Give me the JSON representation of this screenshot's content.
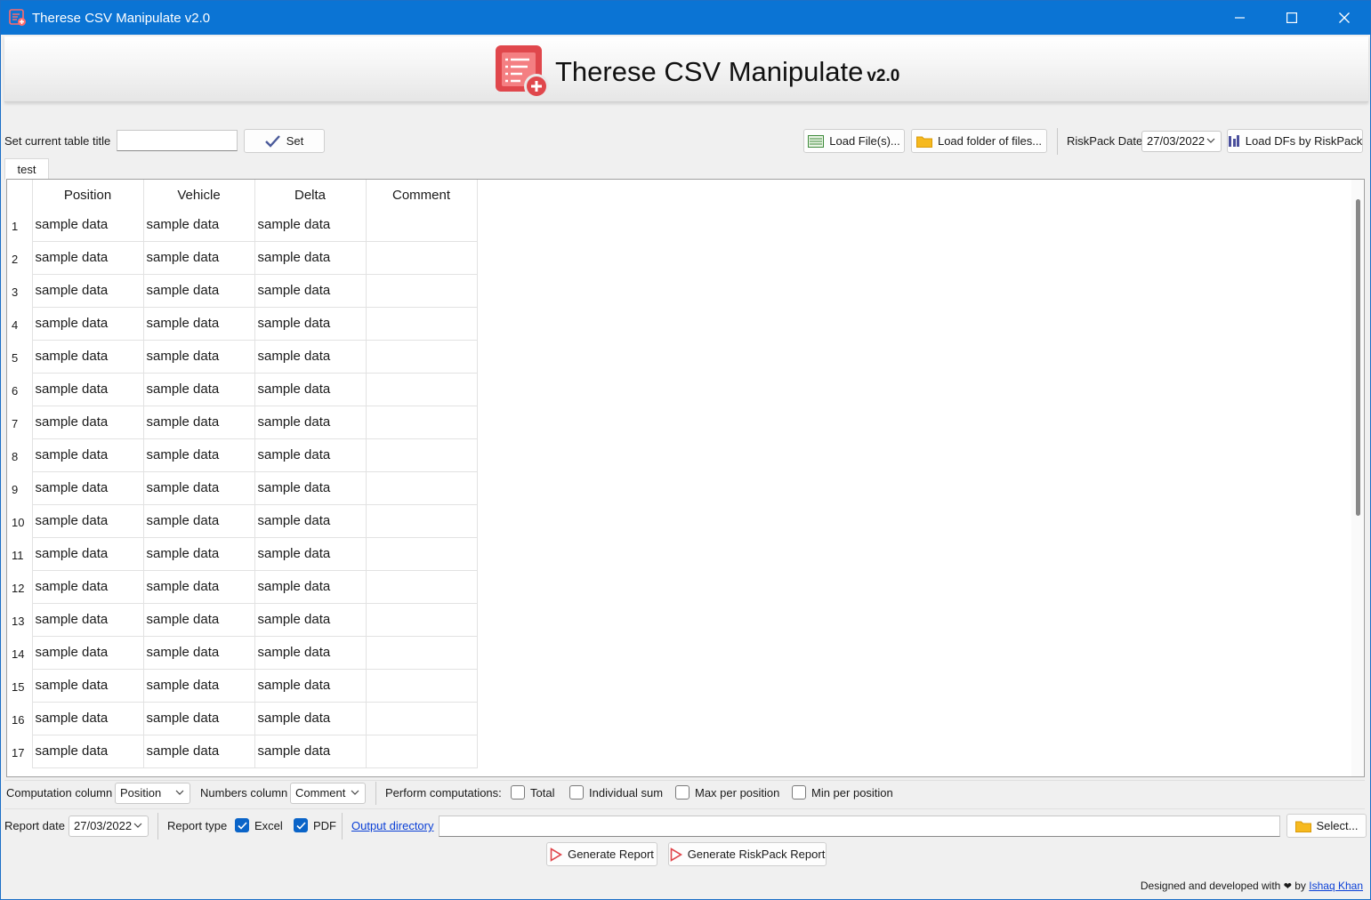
{
  "window": {
    "title": "Therese CSV Manipulate v2.0"
  },
  "header": {
    "app_name": "Therese CSV Manipulate",
    "version": "v2.0"
  },
  "toolbar": {
    "table_title_label": "Set current table title",
    "table_title_value": "",
    "set_button": "Set",
    "load_files_button": "Load File(s)...",
    "load_folder_button": "Load folder of files...",
    "riskpack_date_label": "RiskPack Date",
    "riskpack_date_value": "27/03/2022",
    "load_dfs_button": "Load DFs by RiskPack"
  },
  "tabs": [
    {
      "label": "test",
      "active": true
    }
  ],
  "table": {
    "columns": [
      "Position",
      "Vehicle",
      "Delta",
      "Comment"
    ],
    "rows": [
      {
        "n": "1",
        "cells": [
          "sample data",
          "sample data",
          "sample data",
          ""
        ]
      },
      {
        "n": "2",
        "cells": [
          "sample data",
          "sample data",
          "sample data",
          ""
        ]
      },
      {
        "n": "3",
        "cells": [
          "sample data",
          "sample data",
          "sample data",
          ""
        ]
      },
      {
        "n": "4",
        "cells": [
          "sample data",
          "sample data",
          "sample data",
          ""
        ]
      },
      {
        "n": "5",
        "cells": [
          "sample data",
          "sample data",
          "sample data",
          ""
        ]
      },
      {
        "n": "6",
        "cells": [
          "sample data",
          "sample data",
          "sample data",
          ""
        ]
      },
      {
        "n": "7",
        "cells": [
          "sample data",
          "sample data",
          "sample data",
          ""
        ]
      },
      {
        "n": "8",
        "cells": [
          "sample data",
          "sample data",
          "sample data",
          ""
        ]
      },
      {
        "n": "9",
        "cells": [
          "sample data",
          "sample data",
          "sample data",
          ""
        ]
      },
      {
        "n": "10",
        "cells": [
          "sample data",
          "sample data",
          "sample data",
          ""
        ]
      },
      {
        "n": "11",
        "cells": [
          "sample data",
          "sample data",
          "sample data",
          ""
        ]
      },
      {
        "n": "12",
        "cells": [
          "sample data",
          "sample data",
          "sample data",
          ""
        ]
      },
      {
        "n": "13",
        "cells": [
          "sample data",
          "sample data",
          "sample data",
          ""
        ]
      },
      {
        "n": "14",
        "cells": [
          "sample data",
          "sample data",
          "sample data",
          ""
        ]
      },
      {
        "n": "15",
        "cells": [
          "sample data",
          "sample data",
          "sample data",
          ""
        ]
      },
      {
        "n": "16",
        "cells": [
          "sample data",
          "sample data",
          "sample data",
          ""
        ]
      },
      {
        "n": "17",
        "cells": [
          "sample data",
          "sample data",
          "sample data",
          ""
        ]
      }
    ]
  },
  "computations": {
    "computation_column_label": "Computation column",
    "computation_column_value": "Position",
    "numbers_column_label": "Numbers column",
    "numbers_column_value": "Comment",
    "perform_label": "Perform computations:",
    "options": [
      {
        "label": "Total",
        "checked": false
      },
      {
        "label": "Individual sum",
        "checked": false
      },
      {
        "label": "Max per position",
        "checked": false
      },
      {
        "label": "Min per position",
        "checked": false
      }
    ]
  },
  "report": {
    "report_date_label": "Report date",
    "report_date_value": "27/03/2022",
    "report_type_label": "Report type",
    "excel_label": "Excel",
    "excel_checked": true,
    "pdf_label": "PDF",
    "pdf_checked": true,
    "output_directory_link": "Output directory",
    "output_directory_value": "",
    "select_button": "Select...",
    "generate_report_button": "Generate Report",
    "generate_riskpack_button": "Generate RiskPack Report"
  },
  "footer": {
    "credit_prefix": "Designed and developed with",
    "heart": "❤",
    "credit_by": "by",
    "author_link": "Ishaq Khan"
  },
  "colors": {
    "titlebar": "#0b74d4",
    "accent": "#0a64c8",
    "logo_red": "#e0474c",
    "link": "#0a3fd6"
  }
}
